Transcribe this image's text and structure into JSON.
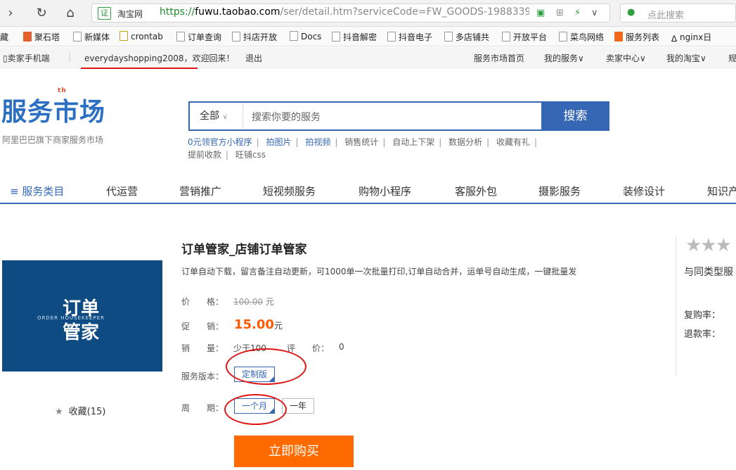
{
  "browser": {
    "cert_label": "证",
    "site_name": "淘宝网",
    "url_scheme": "https://",
    "url_domain": "fuwu.taobao.com",
    "url_path": "/ser/detail.htm?serviceCode=FW_GOODS-1988339&m",
    "search_placeholder": "点此搜索"
  },
  "bookmarks": [
    {
      "label": "藏"
    },
    {
      "label": "聚石塔"
    },
    {
      "label": "新媒体"
    },
    {
      "label": "crontab"
    },
    {
      "label": "订单查询"
    },
    {
      "label": "抖店开放"
    },
    {
      "label": "Docs"
    },
    {
      "label": "抖音解密"
    },
    {
      "label": "抖音电子"
    },
    {
      "label": "多店铺共"
    },
    {
      "label": "开放平台"
    },
    {
      "label": "菜鸟网络"
    },
    {
      "label": "服务列表"
    },
    {
      "label": "nginx日"
    }
  ],
  "topnav": {
    "mobile": "卖家手机端",
    "greeting": "everydayshopping2008，欢迎回来！",
    "logout": "退出",
    "links": [
      "服务市场首页",
      "我的服务∨",
      "卖家中心∨",
      "我的淘宝∨",
      "规"
    ]
  },
  "header": {
    "logo_text": "服务市场",
    "logo_badge": "th",
    "logo_sub": "阿里巴巴旗下商家服务市场",
    "search_category": "全部",
    "search_placeholder": "搜索你要的服务",
    "search_button": "搜索",
    "hot_links": [
      "0元领官方小程序",
      "拍图片",
      "拍视频",
      "销售统计",
      "自动上下架",
      "数据分析",
      "收藏有礼",
      "提前收款",
      "旺铺css"
    ]
  },
  "catnav": [
    "≡ 服务类目",
    "代运营",
    "营销推广",
    "短视频服务",
    "购物小程序",
    "客服外包",
    "摄影服务",
    "装修设计",
    "知识产"
  ],
  "product": {
    "image_line1": "订单",
    "image_line2": "管家",
    "image_small": "ORDER HOUSEKEEPER",
    "favorite": "收藏(15)",
    "title": "订单管家_店铺订单管家",
    "desc": "订单自动下载，留言备注自动更新，可1000单一次批量打印,订单自动合并，运单号自动生成，一键批量发",
    "price_label": "价　　格：",
    "price_old": "100.00",
    "price_unit": "元",
    "promo_label": "促　　销：",
    "promo_price": "15.00",
    "sales_label": "销　　量：",
    "sales_value": "少于100",
    "rating_label": "评　　价：",
    "rating_value": "0",
    "version_label": "服务版本：",
    "version_option": "定制版",
    "period_label": "周　　期：",
    "period_options": [
      "一个月",
      "一年"
    ],
    "buy_button": "立即购买"
  },
  "sidebar": {
    "stars": "★★★",
    "compare": "与同类型服",
    "repurchase": "复购率：",
    "refund": "退款率："
  },
  "colors": {
    "brand_blue": "#3567b5",
    "orange": "#ff6a00",
    "annotation_red": "#e01515"
  }
}
